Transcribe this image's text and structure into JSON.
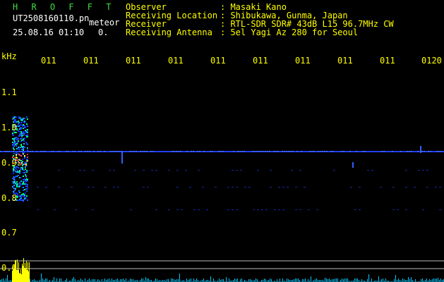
{
  "header": {
    "logo": "H R O F F T",
    "filename": "UT2508160110.pn",
    "tag": "meteor",
    "datetime": "25.08.16 01:10",
    "count": "0."
  },
  "info": [
    {
      "label": "Observer",
      "value": ": Masaki Kano"
    },
    {
      "label": "Receiving Location",
      "value": ": Shibukawa, Gunma, Japan"
    },
    {
      "label": "Receiver",
      "value": ": RTL-SDR SDR# 43dB L15 96.7MHz CW"
    },
    {
      "label": "Receiving Antenna",
      "value": ": 5el Yagi Az 280 for Seoul"
    }
  ],
  "axis": {
    "unit": "kHz",
    "time_ticks": [
      "011",
      "011",
      "011",
      "011",
      "011",
      "011",
      "011",
      "011",
      "011",
      "0120"
    ],
    "freq_ticks": [
      "1.1",
      "1.0",
      "0.9",
      "0.8",
      "0.7",
      "0.6"
    ]
  },
  "colors": {
    "header_logo": "#3ee03e",
    "header_text": "#ffffff",
    "info_text": "#ffff00",
    "background": "#000000",
    "signal_line": "#2040ff",
    "bottom_bars": "#00c8ff",
    "bottom_peak": "#ffff00"
  }
}
